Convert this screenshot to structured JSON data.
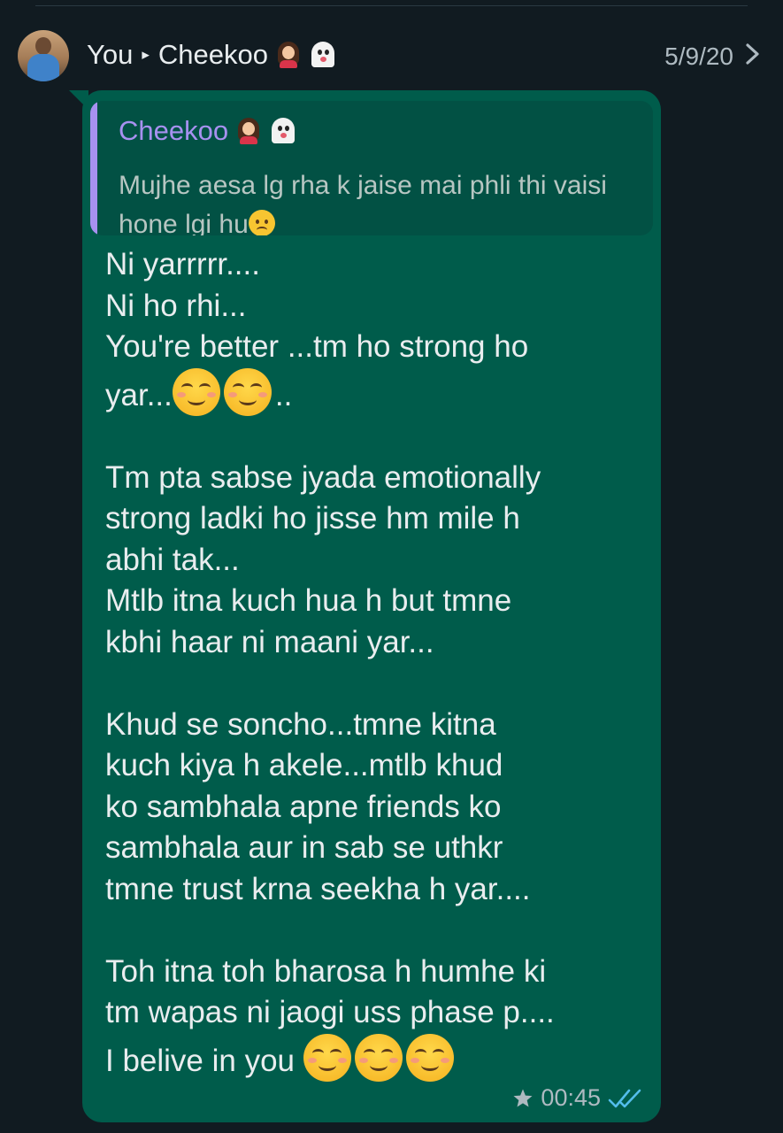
{
  "header": {
    "sender": "You",
    "recipient": "Cheekoo",
    "date": "5/9/20"
  },
  "message": {
    "quote": {
      "author": "Cheekoo",
      "text": "Mujhe aesa lg rha k jaise mai phli thi vaisi hone lgi hu"
    },
    "lines": {
      "l1": "Ni yarrrrr....",
      "l2": "Ni ho rhi...",
      "l3": "You're better ...tm ho strong ho",
      "l4a": "yar...",
      "l4b": "..",
      "p2": "Tm pta sabse jyada emotionally\nstrong ladki ho jisse hm mile h\nabhi tak...\nMtlb itna kuch hua h but tmne\nkbhi haar ni maani yar...",
      "p3": "Khud se soncho...tmne kitna\nkuch kiya h akele...mtlb khud\nko sambhala apne friends ko\nsambhala aur in sab se uthkr\ntmne trust krna seekha h yar....",
      "p4": "Toh itna toh bharosa h humhe ki\ntm wapas ni jaogi uss phase p....",
      "p5": "I belive in you "
    },
    "time": "00:45",
    "starred": true,
    "read_status": "read",
    "icons": {
      "star": "star-icon",
      "ticks": "double-check-icon",
      "chevron": "chevron-right-icon"
    },
    "colors": {
      "bubble": "#005c4b",
      "quote_bg": "#025144",
      "quote_accent": "#a791f0",
      "read_ticks": "#53bdeb",
      "background": "#111b21"
    }
  }
}
